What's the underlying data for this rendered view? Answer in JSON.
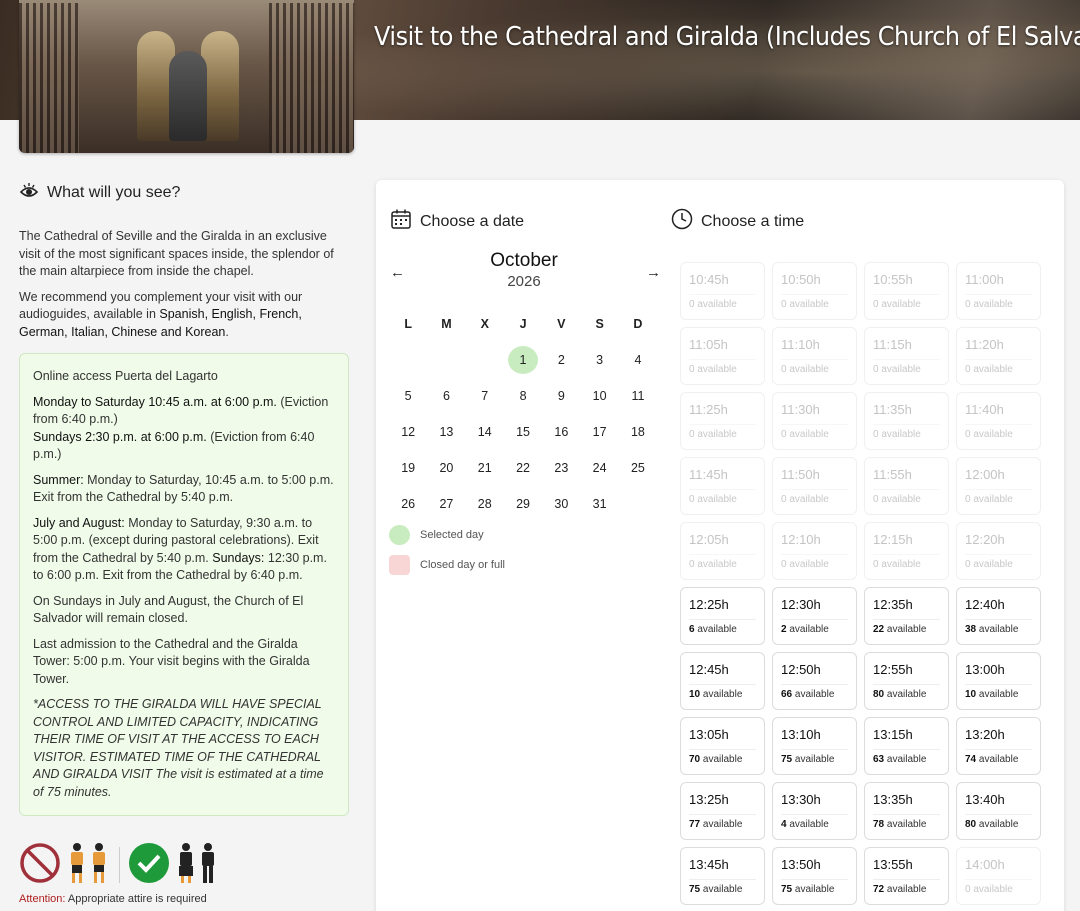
{
  "header": {
    "title": "Visit to the Cathedral and Giralda (Includes Church of El Salvador)"
  },
  "see": {
    "title": "What will you see?",
    "p1": "The Cathedral of Seville and the Giralda in an exclusive visit of the most significant spaces inside, the splendor of the main altarpiece from inside the chapel.",
    "p2_pre": "We recommend you complement your visit with our audioguides, available in ",
    "p2_langs": "Spanish, English, French, German, Italian, Chinese and Korean",
    "p2_post": "."
  },
  "info": {
    "title": "Online access Puerta del Lagarto",
    "l1_bold": "Monday to Saturday 10:45 a.m. at 6:00 p.m.",
    "l1_rest": " (Eviction from 6:40 p.m.)",
    "l2_bold": "Sundays 2:30 p.m. at 6:00 p.m.",
    "l2_rest": " (Eviction from 6:40 p.m.)",
    "summer_bold": "Summer:",
    "summer_rest": " Monday to Saturday, 10:45 a.m. to 5:00 p.m. Exit from the Cathedral by 5:40 p.m.",
    "ja_bold": "July and August:",
    "ja_rest1": " Monday to Saturday, 9:30 a.m. to 5:00 p.m. (except during pastoral celebrations). Exit from the Cathedral by 5:40 p.m. ",
    "ja_bold2": "Sundays:",
    "ja_rest2": " 12:30 p.m. to 6:00 p.m. Exit from the Cathedral by 6:40 p.m.",
    "closed": "On Sundays in July and August, the Church of El Salvador will remain closed.",
    "last": "Last admission to the Cathedral and the Giralda Tower: 5:00 p.m. Your visit begins with the Giralda Tower.",
    "note": "*ACCESS TO THE GIRALDA WILL HAVE SPECIAL CONTROL AND LIMITED CAPACITY, INDICATING THEIR TIME OF VISIT AT THE ACCESS TO EACH VISITOR. ESTIMATED TIME OF THE CATHEDRAL AND GIRALDA VISIT The visit is estimated at a time of 75 minutes."
  },
  "attire": {
    "label": "Attention:",
    "text": " Appropriate attire is required"
  },
  "date": {
    "title": "Choose a date",
    "month": "October",
    "year": "2026",
    "prev": "←",
    "next": "→",
    "weekdays": [
      "L",
      "M",
      "X",
      "J",
      "V",
      "S",
      "D"
    ],
    "weeks": [
      [
        "",
        "",
        "",
        "1",
        "2",
        "3",
        "4"
      ],
      [
        "5",
        "6",
        "7",
        "8",
        "9",
        "10",
        "11"
      ],
      [
        "12",
        "13",
        "14",
        "15",
        "16",
        "17",
        "18"
      ],
      [
        "19",
        "20",
        "21",
        "22",
        "23",
        "24",
        "25"
      ],
      [
        "26",
        "27",
        "28",
        "29",
        "30",
        "31",
        ""
      ]
    ],
    "selected": "1",
    "legend_selected": "Selected day",
    "legend_closed": "Closed day or full"
  },
  "time": {
    "title": "Choose a time",
    "available_label": "available",
    "slots": [
      {
        "time": "10:45h",
        "count": "0",
        "enabled": false
      },
      {
        "time": "10:50h",
        "count": "0",
        "enabled": false
      },
      {
        "time": "10:55h",
        "count": "0",
        "enabled": false
      },
      {
        "time": "11:00h",
        "count": "0",
        "enabled": false
      },
      {
        "time": "11:05h",
        "count": "0",
        "enabled": false
      },
      {
        "time": "11:10h",
        "count": "0",
        "enabled": false
      },
      {
        "time": "11:15h",
        "count": "0",
        "enabled": false
      },
      {
        "time": "11:20h",
        "count": "0",
        "enabled": false
      },
      {
        "time": "11:25h",
        "count": "0",
        "enabled": false
      },
      {
        "time": "11:30h",
        "count": "0",
        "enabled": false
      },
      {
        "time": "11:35h",
        "count": "0",
        "enabled": false
      },
      {
        "time": "11:40h",
        "count": "0",
        "enabled": false
      },
      {
        "time": "11:45h",
        "count": "0",
        "enabled": false
      },
      {
        "time": "11:50h",
        "count": "0",
        "enabled": false
      },
      {
        "time": "11:55h",
        "count": "0",
        "enabled": false
      },
      {
        "time": "12:00h",
        "count": "0",
        "enabled": false
      },
      {
        "time": "12:05h",
        "count": "0",
        "enabled": false
      },
      {
        "time": "12:10h",
        "count": "0",
        "enabled": false
      },
      {
        "time": "12:15h",
        "count": "0",
        "enabled": false
      },
      {
        "time": "12:20h",
        "count": "0",
        "enabled": false
      },
      {
        "time": "12:25h",
        "count": "6",
        "enabled": true
      },
      {
        "time": "12:30h",
        "count": "2",
        "enabled": true
      },
      {
        "time": "12:35h",
        "count": "22",
        "enabled": true
      },
      {
        "time": "12:40h",
        "count": "38",
        "enabled": true
      },
      {
        "time": "12:45h",
        "count": "10",
        "enabled": true
      },
      {
        "time": "12:50h",
        "count": "66",
        "enabled": true
      },
      {
        "time": "12:55h",
        "count": "80",
        "enabled": true
      },
      {
        "time": "13:00h",
        "count": "10",
        "enabled": true
      },
      {
        "time": "13:05h",
        "count": "70",
        "enabled": true
      },
      {
        "time": "13:10h",
        "count": "75",
        "enabled": true
      },
      {
        "time": "13:15h",
        "count": "63",
        "enabled": true
      },
      {
        "time": "13:20h",
        "count": "74",
        "enabled": true
      },
      {
        "time": "13:25h",
        "count": "77",
        "enabled": true
      },
      {
        "time": "13:30h",
        "count": "4",
        "enabled": true
      },
      {
        "time": "13:35h",
        "count": "78",
        "enabled": true
      },
      {
        "time": "13:40h",
        "count": "80",
        "enabled": true
      },
      {
        "time": "13:45h",
        "count": "75",
        "enabled": true
      },
      {
        "time": "13:50h",
        "count": "75",
        "enabled": true
      },
      {
        "time": "13:55h",
        "count": "72",
        "enabled": true
      },
      {
        "time": "14:00h",
        "count": "0",
        "enabled": false
      }
    ]
  },
  "colors": {
    "selected_day": "#c8ecc0",
    "closed_day": "#f8d6d6",
    "info_bg": "#f0fbe9",
    "attention": "#b02020",
    "ok_green": "#1f9a3a",
    "forbidden_red": "#a0303a"
  }
}
